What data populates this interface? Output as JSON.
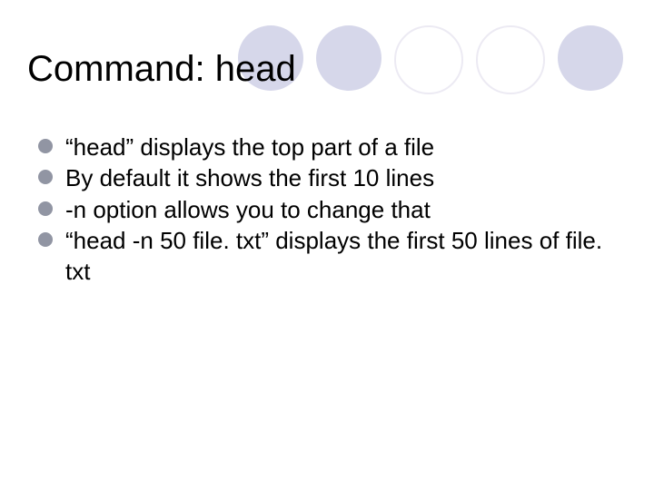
{
  "title": "Command: head",
  "bullets": [
    "“head” displays the top part of a file",
    " By default it shows the first 10 lines",
    " -n option allows you to change that",
    " “head -n 50 file. txt” displays the first 50 lines of file. txt"
  ]
}
